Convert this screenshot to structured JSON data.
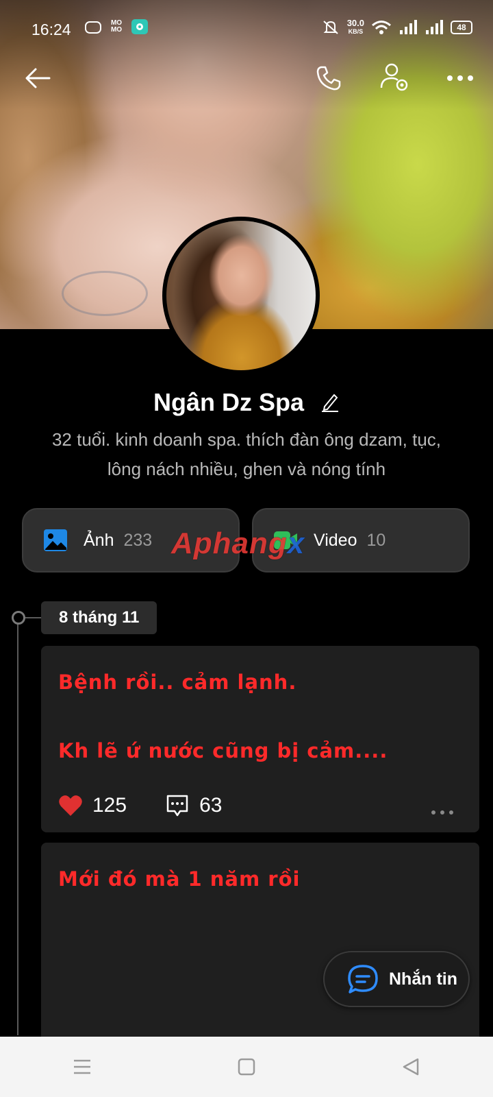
{
  "status_bar": {
    "time": "16:24",
    "app_icons": [
      "gamepad-icon",
      "momo-icon",
      "chat-app-icon"
    ],
    "momo_text": "MO MO",
    "net_speed": "30.0",
    "net_speed_unit": "KB/S",
    "battery": "48"
  },
  "header": {
    "back_icon": "arrow-left-icon",
    "call_icon": "phone-icon",
    "settings_icon": "user-settings-icon",
    "more_icon": "more-horizontal-icon"
  },
  "profile": {
    "name": "Ngân Dz Spa",
    "bio_line1": "32 tuổi. kinh doanh spa. thích đàn ông dzam, tục,",
    "bio_line2": "lông nách nhiều, ghen và nóng tính"
  },
  "media": {
    "photos_label": "Ảnh",
    "photos_count": "233",
    "videos_label": "Video",
    "videos_count": "10"
  },
  "watermark": {
    "part1": "Aphang",
    "part2": "x"
  },
  "timeline": {
    "date": "8 tháng 11",
    "posts": [
      {
        "line1": "Bệnh rồi.. cảm lạnh.",
        "line2": "Kh lẽ ứ nước cũng bị cảm....",
        "likes": "125",
        "comments": "63"
      },
      {
        "line1": "Mới đó mà 1 năm rồi"
      }
    ]
  },
  "message_button": {
    "label": "Nhắn tin"
  },
  "colors": {
    "post_text": "#ff2a2a",
    "like_heart": "#e03131",
    "photo_icon": "#1e88e5",
    "video_icon": "#2fbf5a",
    "message_icon": "#2f8cff"
  }
}
